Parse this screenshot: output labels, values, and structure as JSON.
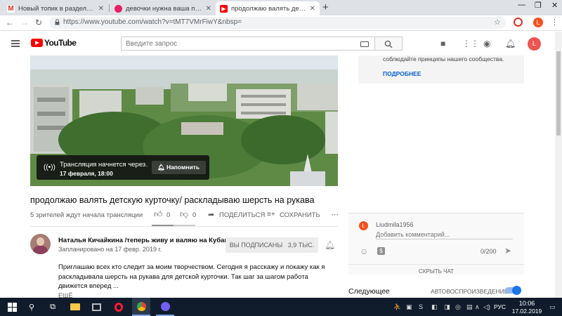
{
  "browser": {
    "tabs": [
      {
        "title": "Новый топик в разделе «Валяние»",
        "favicon": "gmail-icon"
      },
      {
        "title": "девочки нужна ваша помощь - …",
        "favicon": "forum-icon"
      },
      {
        "title": "продолжаю валять детскую курточку",
        "favicon": "youtube-icon"
      }
    ],
    "new_tab": "+",
    "url": "https://www.youtube.com/watch?v=tMT7VMrFiwY&nbsp=",
    "profile_initial": "L"
  },
  "youtube": {
    "logo_text": "YouTube",
    "search_placeholder": "Введите запрос",
    "avatar_initial": "L"
  },
  "video": {
    "notification_title": "Трансляция начнется через…",
    "notification_date": "17 февраля, 18:00",
    "remind_label": "Напомнить",
    "title": "продолжаю валять детскую курточку/ раскладываю шерсть на рукава",
    "waiting": "5 зрителей ждут начала трансляции",
    "likes": "0",
    "dislikes": "0",
    "like_ratio": 0.5,
    "share_label": "ПОДЕЛИТЬСЯ",
    "save_label": "СОХРАНИТЬ"
  },
  "channel": {
    "name": "Наталья Кичайкина /теперь живу и валяю на Кубани",
    "scheduled": "Запланировано на 17 февр. 2019 г.",
    "subscribed_label": "ВЫ ПОДПИСАНЫ",
    "subscriber_count": "3,9 ТЫС.",
    "description": "Приглашаю всех кто следит за моим творчеством. Сегодня я расскажу и покажу как я раскладывала шерсть на рукава для детской курточки. Так шаг за шагом работа движется вперед  ...",
    "more_label": "ЕЩЁ"
  },
  "chat_panel": {
    "guidelines_text": "соблюдайте принципы нашего сообщества.",
    "more_link": "ПОДРОБНЕЕ",
    "user_initial": "L",
    "username": "Liudmila1956",
    "input_placeholder": "Добавить комментарий...",
    "char_count": "0/200",
    "hide_chat": "СКРЫТЬ ЧАТ"
  },
  "up_next": {
    "label": "Следующее",
    "autoplay_label": "АВТОВОСПРОИЗВЕДЕНИЕ",
    "autoplay_on": true
  },
  "taskbar": {
    "language": "РУС",
    "time": "10:06",
    "date": "17.02.2019"
  },
  "colors": {
    "youtube_red": "#ff0000",
    "link_blue": "#065fd4",
    "taskbar": "#101c2c"
  }
}
